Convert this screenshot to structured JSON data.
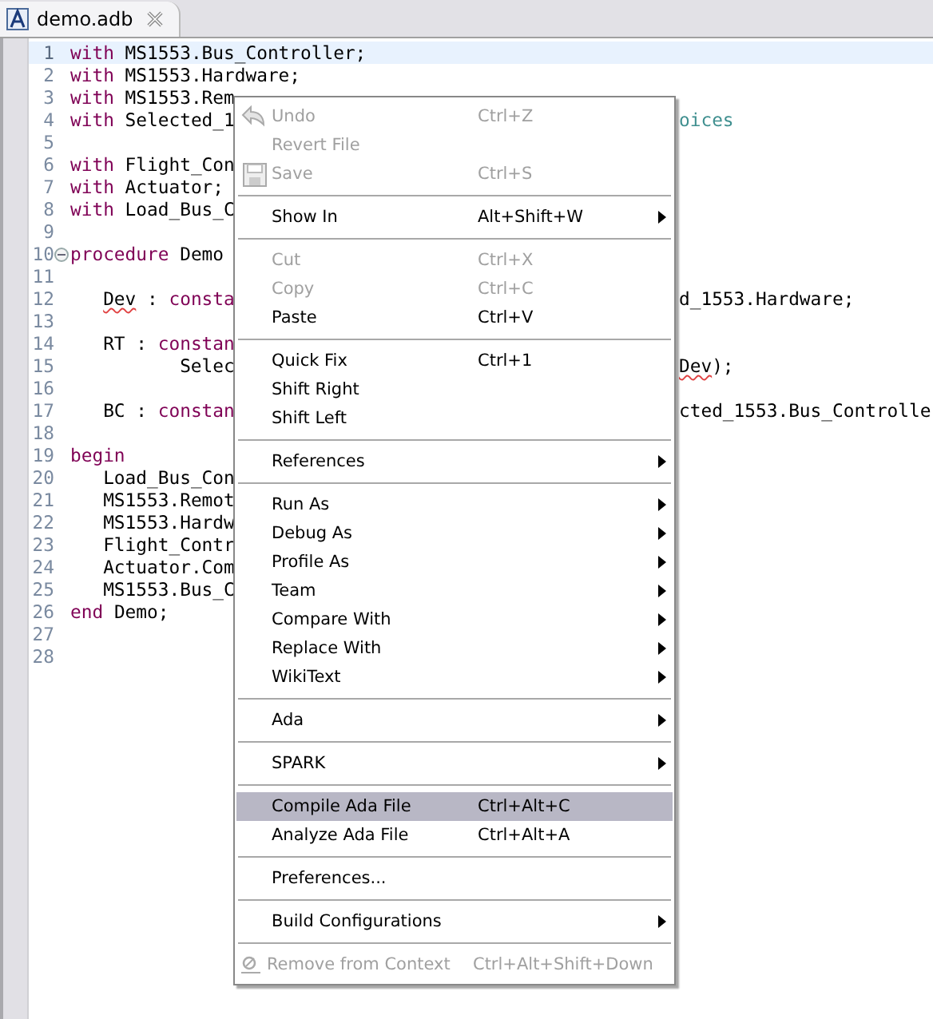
{
  "tab": {
    "label": "demo.adb",
    "selected": true
  },
  "code_lines": [
    {
      "number": "1",
      "current": true,
      "segments": [
        {
          "text": "with",
          "kind": "keyword"
        },
        {
          "text": " MS1553.Bus_Controller;",
          "kind": "plain"
        }
      ]
    },
    {
      "number": "2",
      "current": false,
      "segments": [
        {
          "text": "with",
          "kind": "keyword"
        },
        {
          "text": " MS1553.Hardware;",
          "kind": "plain"
        }
      ]
    },
    {
      "number": "3",
      "current": false,
      "segments": [
        {
          "text": "with",
          "kind": "keyword"
        },
        {
          "text": " MS1553.Rem",
          "kind": "plain"
        }
      ]
    },
    {
      "number": "4",
      "current": false,
      "segments": [
        {
          "text": "with",
          "kind": "keyword"
        },
        {
          "text": " Selected_1",
          "kind": "plain"
        }
      ],
      "right": [
        {
          "text": "oices",
          "kind": "comment"
        }
      ]
    },
    {
      "number": "5",
      "current": false
    },
    {
      "number": "6",
      "current": false,
      "segments": [
        {
          "text": "with",
          "kind": "keyword"
        },
        {
          "text": " Flight_Con",
          "kind": "plain"
        }
      ]
    },
    {
      "number": "7",
      "current": false,
      "segments": [
        {
          "text": "with",
          "kind": "keyword"
        },
        {
          "text": " Actuator;",
          "kind": "plain"
        }
      ]
    },
    {
      "number": "8",
      "current": false,
      "segments": [
        {
          "text": "with",
          "kind": "keyword"
        },
        {
          "text": " Load_Bus_C",
          "kind": "plain"
        }
      ]
    },
    {
      "number": "9",
      "current": false
    },
    {
      "number": "10",
      "current": false,
      "folded": false,
      "segments": [
        {
          "text": "procedure",
          "kind": "keyword"
        },
        {
          "text": " Demo",
          "kind": "plain"
        }
      ]
    },
    {
      "number": "11",
      "current": false
    },
    {
      "number": "12",
      "current": false,
      "segments": [
        {
          "text": "   Dev",
          "kind": "error"
        },
        {
          "text": " : ",
          "kind": "plain"
        },
        {
          "text": "consta",
          "kind": "keyword"
        }
      ],
      "right": [
        {
          "text": "d_1553.Hardware;",
          "kind": "plain"
        }
      ]
    },
    {
      "number": "13",
      "current": false
    },
    {
      "number": "14",
      "current": false,
      "segments": [
        {
          "text": "   RT : ",
          "kind": "plain"
        },
        {
          "text": "constan",
          "kind": "keyword"
        }
      ]
    },
    {
      "number": "15",
      "current": false,
      "segments": [
        {
          "text": "          Selec",
          "kind": "plain"
        }
      ],
      "right": [
        {
          "text": "Dev",
          "kind": "error"
        },
        {
          "text": ");",
          "kind": "plain"
        }
      ]
    },
    {
      "number": "16",
      "current": false
    },
    {
      "number": "17",
      "current": false,
      "segments": [
        {
          "text": "   BC : ",
          "kind": "plain"
        },
        {
          "text": "constan",
          "kind": "keyword"
        }
      ],
      "right": [
        {
          "text": "cted_1553.Bus_Controlle",
          "kind": "plain"
        }
      ]
    },
    {
      "number": "18",
      "current": false
    },
    {
      "number": "19",
      "current": false,
      "segments": [
        {
          "text": "begin",
          "kind": "keyword"
        }
      ]
    },
    {
      "number": "20",
      "current": false,
      "segments": [
        {
          "text": "   Load_Bus_Con",
          "kind": "plain"
        }
      ]
    },
    {
      "number": "21",
      "current": false,
      "segments": [
        {
          "text": "   MS1553.Remot",
          "kind": "plain"
        }
      ]
    },
    {
      "number": "22",
      "current": false,
      "segments": [
        {
          "text": "   MS1553.Hardw",
          "kind": "plain"
        }
      ]
    },
    {
      "number": "23",
      "current": false,
      "segments": [
        {
          "text": "   Flight_Contr",
          "kind": "plain"
        }
      ]
    },
    {
      "number": "24",
      "current": false,
      "segments": [
        {
          "text": "   Actuator.Com",
          "kind": "plain"
        }
      ]
    },
    {
      "number": "25",
      "current": false,
      "segments": [
        {
          "text": "   MS1553.Bus_C",
          "kind": "plain"
        }
      ]
    },
    {
      "number": "26",
      "current": false,
      "segments": [
        {
          "text": "end",
          "kind": "keyword"
        },
        {
          "text": " Demo;",
          "kind": "plain"
        }
      ]
    },
    {
      "number": "27",
      "current": false
    },
    {
      "number": "28",
      "current": false
    }
  ],
  "context_menu": {
    "groups": [
      [
        {
          "label": "Undo",
          "shortcut": "Ctrl+Z",
          "disabled": true,
          "submenu": false,
          "selected": false
        },
        {
          "label": "Revert File",
          "disabled": true,
          "submenu": false,
          "selected": false
        },
        {
          "label": "Save",
          "shortcut": "Ctrl+S",
          "disabled": true,
          "submenu": false,
          "selected": false
        }
      ],
      [
        {
          "label": "Show In",
          "shortcut": "Alt+Shift+W",
          "disabled": false,
          "submenu": true,
          "selected": false
        }
      ],
      [
        {
          "label": "Cut",
          "shortcut": "Ctrl+X",
          "disabled": true,
          "submenu": false,
          "selected": false
        },
        {
          "label": "Copy",
          "shortcut": "Ctrl+C",
          "disabled": true,
          "submenu": false,
          "selected": false
        },
        {
          "label": "Paste",
          "shortcut": "Ctrl+V",
          "disabled": false,
          "submenu": false,
          "selected": false
        }
      ],
      [
        {
          "label": "Quick Fix",
          "shortcut": "Ctrl+1",
          "disabled": false,
          "submenu": false,
          "selected": false
        },
        {
          "label": "Shift Right",
          "disabled": false,
          "submenu": false,
          "selected": false
        },
        {
          "label": "Shift Left",
          "disabled": false,
          "submenu": false,
          "selected": false
        }
      ],
      [
        {
          "label": "References",
          "disabled": false,
          "submenu": true,
          "selected": false
        }
      ],
      [
        {
          "label": "Run As",
          "disabled": false,
          "submenu": true,
          "selected": false
        },
        {
          "label": "Debug As",
          "disabled": false,
          "submenu": true,
          "selected": false
        },
        {
          "label": "Profile As",
          "disabled": false,
          "submenu": true,
          "selected": false
        },
        {
          "label": "Team",
          "disabled": false,
          "submenu": true,
          "selected": false
        },
        {
          "label": "Compare With",
          "disabled": false,
          "submenu": true,
          "selected": false
        },
        {
          "label": "Replace With",
          "disabled": false,
          "submenu": true,
          "selected": false
        },
        {
          "label": "WikiText",
          "disabled": false,
          "submenu": true,
          "selected": false
        }
      ],
      [
        {
          "label": "Ada",
          "disabled": false,
          "submenu": true,
          "selected": false
        }
      ],
      [
        {
          "label": "SPARK",
          "disabled": false,
          "submenu": true,
          "selected": false
        }
      ],
      [
        {
          "label": "Compile Ada File",
          "shortcut": "Ctrl+Alt+C",
          "disabled": false,
          "submenu": false,
          "selected": true
        },
        {
          "label": "Analyze Ada File",
          "shortcut": "Ctrl+Alt+A",
          "disabled": false,
          "submenu": false,
          "selected": false
        }
      ],
      [
        {
          "label": "Preferences...",
          "disabled": false,
          "submenu": false,
          "selected": false
        }
      ],
      [
        {
          "label": "Build Configurations",
          "disabled": false,
          "submenu": true,
          "selected": false
        }
      ],
      [
        {
          "label": "Remove from Context",
          "shortcut": "Ctrl+Alt+Shift+Down",
          "disabled": true,
          "submenu": false,
          "selected": false
        }
      ]
    ]
  }
}
